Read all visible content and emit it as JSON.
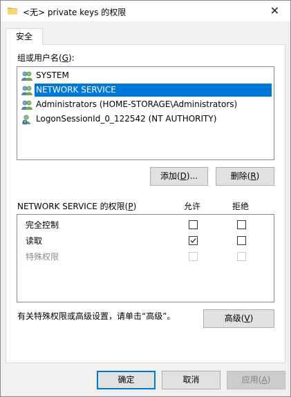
{
  "window": {
    "title": "<无> private keys 的权限",
    "close_glyph": "✕"
  },
  "tab": {
    "label": "安全"
  },
  "groups": {
    "label_prefix": "组或用户名(",
    "label_accel": "G",
    "label_suffix": "):",
    "items": [
      {
        "name": "SYSTEM",
        "icon": "users-group-icon",
        "selected": false
      },
      {
        "name": "NETWORK SERVICE",
        "icon": "users-group-icon",
        "selected": true
      },
      {
        "name": "Administrators (HOME-STORAGE\\Administrators)",
        "icon": "users-group-icon",
        "selected": false
      },
      {
        "name": "LogonSessionId_0_122542 (NT AUTHORITY)",
        "icon": "user-question-icon",
        "selected": false
      }
    ]
  },
  "buttons": {
    "add": {
      "prefix": "添加(",
      "accel": "D",
      "suffix": ")..."
    },
    "remove": {
      "prefix": "删除(",
      "accel": "R",
      "suffix": ")"
    },
    "advanced": {
      "prefix": "高级(",
      "accel": "V",
      "suffix": ")"
    },
    "ok": "确定",
    "cancel": "取消",
    "apply": {
      "prefix": "应用(",
      "accel": "A",
      "suffix": ")"
    }
  },
  "permissions": {
    "label_prefix": "NETWORK SERVICE 的权限(",
    "label_accel": "P",
    "label_suffix": ")",
    "allow_header": "允许",
    "deny_header": "拒绝",
    "rows": [
      {
        "name": "完全控制",
        "allow": false,
        "deny": false,
        "enabled": true
      },
      {
        "name": "读取",
        "allow": true,
        "deny": false,
        "enabled": true
      },
      {
        "name": "特殊权限",
        "allow": false,
        "deny": false,
        "enabled": false
      }
    ]
  },
  "advanced_hint": "有关特殊权限或高级设置，请单击“高级”。",
  "colors": {
    "selection": "#0078d7",
    "default_button_border": "#0078d7",
    "dialog_bg": "#f0f0f0"
  }
}
